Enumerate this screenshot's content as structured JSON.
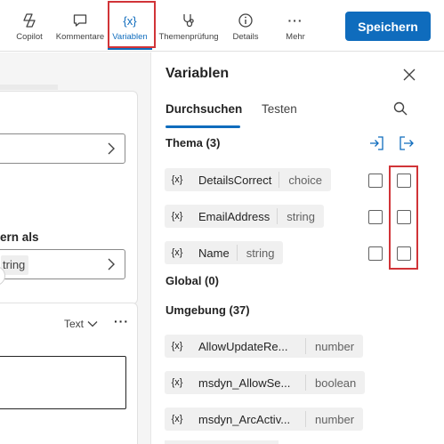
{
  "toolbar": {
    "copilot": "Copilot",
    "comments": "Kommentare",
    "variables": "Variablen",
    "topic_check": "Themenprüfung",
    "details": "Details",
    "more": "Mehr",
    "save": "Speichern",
    "accent": "#0f6cbd",
    "highlight": "#d13438"
  },
  "canvas": {
    "partial_text": "ern als",
    "pill_text": "tring",
    "text_dropdown": "Text"
  },
  "panel": {
    "title": "Variablen",
    "tabs": [
      {
        "label": "Durchsuchen",
        "active": true
      },
      {
        "label": "Testen",
        "active": false
      }
    ],
    "sections": {
      "thema": "Thema (3)",
      "global": "Global (0)",
      "umgebung": "Umgebung (37)"
    },
    "thema_vars": [
      {
        "icon": "{x}",
        "name": "DetailsCorrect",
        "type": "choice"
      },
      {
        "icon": "{x}",
        "name": "EmailAddress",
        "type": "string"
      },
      {
        "icon": "{x}",
        "name": "Name",
        "type": "string"
      }
    ],
    "env_vars": [
      {
        "icon": "{x}",
        "name": "AllowUpdateRe...",
        "type": "number"
      },
      {
        "icon": "{x}",
        "name": "msdyn_AllowSe...",
        "type": "boolean"
      },
      {
        "icon": "{x}",
        "name": "msdyn_ArcActiv...",
        "type": "number"
      }
    ]
  }
}
